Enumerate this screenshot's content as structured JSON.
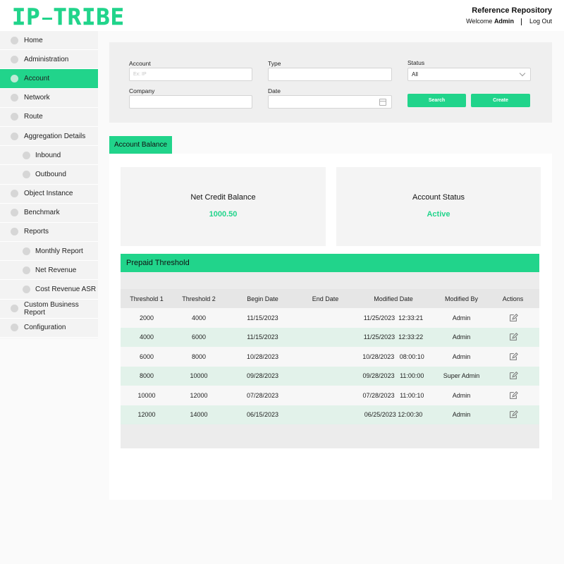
{
  "header": {
    "logo_text": "IP-TRIBE",
    "logo_left": "IP",
    "logo_right": "TRIBE",
    "title": "Reference Repository",
    "welcome": "Welcome",
    "user": "Admin",
    "logout": "Log Out"
  },
  "sidebar": {
    "items": [
      {
        "label": "Home"
      },
      {
        "label": "Administration"
      },
      {
        "label": "Account"
      },
      {
        "label": "Network"
      },
      {
        "label": "Route"
      },
      {
        "label": "Aggregation Details"
      },
      {
        "label": "Inbound"
      },
      {
        "label": "Outbound"
      },
      {
        "label": "Object Instance"
      },
      {
        "label": "Benchmark"
      },
      {
        "label": "Reports"
      },
      {
        "label": "Monthly Report"
      },
      {
        "label": "Net Revenue"
      },
      {
        "label": "Cost Revenue ASR"
      },
      {
        "label": "Custom Business Report"
      },
      {
        "label": "Configuration"
      }
    ],
    "active": "Account"
  },
  "filters": {
    "account_label": "Account",
    "account_placeholder": "Ex: IP",
    "type_label": "Type",
    "status_label": "Status",
    "status_value": "All",
    "company_label": "Company",
    "date_label": "Date",
    "search_button": "Search",
    "create_button": "Create"
  },
  "tabs": {
    "account_balance": "Account Balance"
  },
  "cards": {
    "net_credit_title": "Net Credit Balance",
    "net_credit_value": "1000.50",
    "status_title": "Account Status",
    "status_value": "Active"
  },
  "threshold": {
    "title": "Prepaid Threshold",
    "columns": [
      "Threshold 1",
      "Threshold 2",
      "Begin Date",
      "End Date",
      "Modified Date",
      "Modified By",
      "Actions"
    ],
    "rows": [
      {
        "t1": "2000",
        "t2": "4000",
        "begin": "11/15/2023",
        "end": "",
        "modified": "11/25/2023  12:33:21",
        "by": "Admin"
      },
      {
        "t1": "4000",
        "t2": "6000",
        "begin": "11/15/2023",
        "end": "",
        "modified": "11/25/2023  12:33:22",
        "by": "Admin"
      },
      {
        "t1": "6000",
        "t2": "8000",
        "begin": "10/28/2023",
        "end": "",
        "modified": "10/28/2023   08:00:10",
        "by": "Admin"
      },
      {
        "t1": "8000",
        "t2": "10000",
        "begin": "09/28/2023",
        "end": "",
        "modified": "09/28/2023   11:00:00",
        "by": "Super Admin"
      },
      {
        "t1": "10000",
        "t2": "12000",
        "begin": "07/28/2023",
        "end": "",
        "modified": "07/28/2023   11:00:10",
        "by": "Admin"
      },
      {
        "t1": "12000",
        "t2": "14000",
        "begin": "06/15/2023",
        "end": "",
        "modified": "06/25/2023 12:00:30",
        "by": "Admin"
      }
    ],
    "action_icon": "edit-icon"
  },
  "colors": {
    "accent": "#21d48b",
    "row_alt": "#e2f2ea"
  }
}
